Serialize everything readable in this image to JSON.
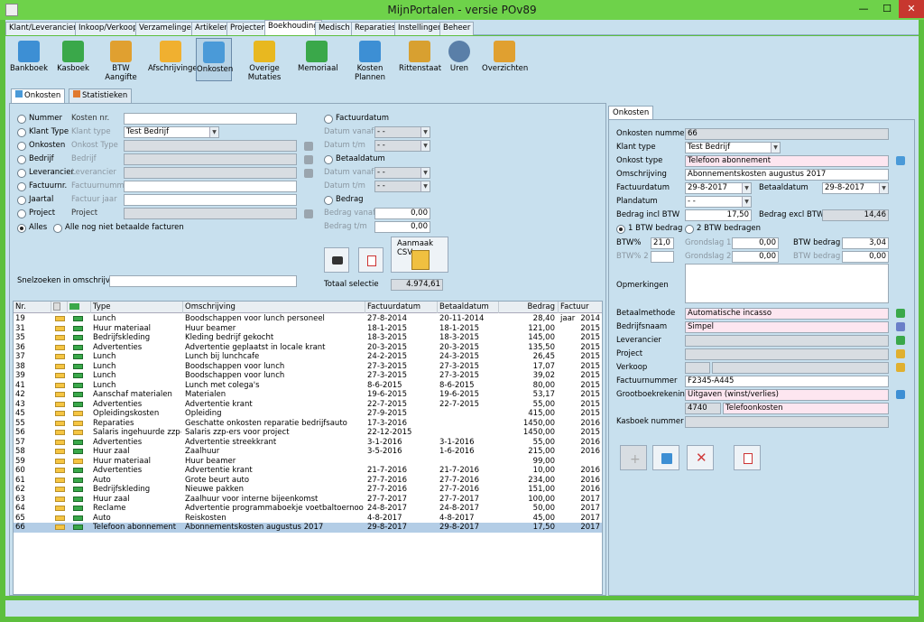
{
  "window": {
    "title": "MijnPortalen - versie POv89",
    "minimize": "—",
    "maximize": "☐",
    "close": "✕"
  },
  "menu": [
    "Klant/Leverancier",
    "Inkoop/Verkoop",
    "Verzamelingen",
    "Artikelen",
    "Projecten",
    "Boekhouding",
    "Medisch",
    "Reparaties",
    "Instellingen",
    "Beheer"
  ],
  "toolbar": [
    {
      "label": "Bankboek",
      "icon": "book-icon",
      "color": "#3d8fd4"
    },
    {
      "label": "Kasboek",
      "icon": "cashbox-icon",
      "color": "#3aa84a"
    },
    {
      "label": "BTW Aangifte",
      "icon": "tax-form-icon",
      "color": "#e0a030"
    },
    {
      "label": "Afschrijvingen",
      "icon": "folder-icon",
      "color": "#f0b030"
    },
    {
      "label": "Onkosten",
      "icon": "tag-icon",
      "color": "#4a9ad8"
    },
    {
      "label": "Overige Mutaties",
      "icon": "swap-folder-icon",
      "color": "#e8b820"
    },
    {
      "label": "Memoriaal",
      "icon": "arrows-icon",
      "color": "#3aa84a"
    },
    {
      "label": "Kosten Plannen",
      "icon": "bar-chart-icon",
      "color": "#3d8fd4"
    },
    {
      "label": "Rittenstaat",
      "icon": "car-icon",
      "color": "#d8a030"
    },
    {
      "label": "Uren",
      "icon": "clock-icon",
      "color": "#5a7fa8"
    },
    {
      "label": "Overzichten",
      "icon": "magnifier-icon",
      "color": "#e0a030"
    }
  ],
  "tabs": {
    "onkosten": "Onkosten",
    "statistieken": "Statistieken"
  },
  "filter": {
    "left": [
      {
        "radio": "Nummer",
        "label": "Kosten nr.",
        "value": "",
        "gray": false
      },
      {
        "radio": "Klant Type",
        "label": "Klant type",
        "value": "Test Bedrijf",
        "gray": false,
        "dropdown": true
      },
      {
        "radio": "Onkosten",
        "label": "Onkost Type",
        "value": "",
        "gray": true
      },
      {
        "radio": "Bedrijf",
        "label": "Bedrijf",
        "value": "",
        "gray": true
      },
      {
        "radio": "Leverancier",
        "label": "Leverancier",
        "value": "",
        "gray": true
      },
      {
        "radio": "Factuurnr.",
        "label": "Factuurnummer",
        "value": "",
        "gray": false
      },
      {
        "radio": "Jaartal",
        "label": "Factuur jaar",
        "value": "",
        "gray": false
      },
      {
        "radio": "Project",
        "label": "Project",
        "value": "",
        "gray": true
      }
    ],
    "alles": "Alles",
    "nietbetaald": "Alle nog niet betaalde facturen",
    "snelzoeken": "Snelzoeken in omschrijving",
    "factuurdatum": "Factuurdatum",
    "datum_vanaf": "Datum vanaf",
    "datum_tm": "Datum t/m",
    "betaaldatum": "Betaaldatum",
    "bedrag": "Bedrag",
    "bedrag_vanaf": "Bedrag vanaf",
    "bedrag_tm": "Bedrag t/m",
    "bedrag_vanaf_val": "0,00",
    "bedrag_tm_val": "0,00",
    "date_placeholder": "- -",
    "csv": "Aanmaak CSV",
    "totaal_label": "Totaal selectie",
    "totaal_value": "4.974,61"
  },
  "grid": {
    "headers": [
      "Nr.",
      "",
      "",
      "Type",
      "Omschrijving",
      "Factuurdatum",
      "Betaaldatum",
      "Bedrag",
      "Factuur jaar"
    ],
    "rows": [
      [
        "19",
        "Lunch",
        "Boodschappen voor lunch personeel",
        "27-8-2014",
        "20-11-2014",
        "28,40",
        "2014"
      ],
      [
        "31",
        "Huur materiaal",
        "Huur beamer",
        "18-1-2015",
        "18-1-2015",
        "121,00",
        "2015"
      ],
      [
        "35",
        "Bedrijfskleding",
        "Kleding bedrijf gekocht",
        "18-3-2015",
        "18-3-2015",
        "145,00",
        "2015"
      ],
      [
        "36",
        "Advertenties",
        "Advertentie geplaatst in locale krant",
        "20-3-2015",
        "20-3-2015",
        "135,50",
        "2015"
      ],
      [
        "37",
        "Lunch",
        "Lunch bij lunchcafe",
        "24-2-2015",
        "24-3-2015",
        "26,45",
        "2015"
      ],
      [
        "38",
        "Lunch",
        "Boodschappen voor lunch",
        "27-3-2015",
        "27-3-2015",
        "17,07",
        "2015"
      ],
      [
        "39",
        "Lunch",
        "Boodschappen voor lunch",
        "27-3-2015",
        "27-3-2015",
        "39,02",
        "2015"
      ],
      [
        "41",
        "Lunch",
        "Lunch met colega's",
        "8-6-2015",
        "8-6-2015",
        "80,00",
        "2015"
      ],
      [
        "42",
        "Aanschaf materialen",
        "Materialen",
        "19-6-2015",
        "19-6-2015",
        "53,17",
        "2015"
      ],
      [
        "43",
        "Advertenties",
        "Advertentie krant",
        "22-7-2015",
        "22-7-2015",
        "55,00",
        "2015"
      ],
      [
        "45",
        "Opleidingskosten",
        "Opleiding",
        "27-9-2015",
        "",
        "415,00",
        "2015"
      ],
      [
        "55",
        "Reparaties",
        "Geschatte onkosten reparatie bedrijfsauto",
        "17-3-2016",
        "",
        "1450,00",
        "2016"
      ],
      [
        "56",
        "Salaris ingehuurde zzp-ers",
        "Salaris zzp-ers voor project",
        "22-12-2015",
        "",
        "1450,00",
        "2015"
      ],
      [
        "57",
        "Advertenties",
        "Advertentie streekkrant",
        "3-1-2016",
        "3-1-2016",
        "55,00",
        "2016"
      ],
      [
        "58",
        "Huur zaal",
        "Zaalhuur",
        "3-5-2016",
        "1-6-2016",
        "215,00",
        "2016"
      ],
      [
        "59",
        "Huur materiaal",
        "Huur beamer",
        "",
        "",
        "99,00",
        ""
      ],
      [
        "60",
        "Advertenties",
        "Advertentie krant",
        "21-7-2016",
        "21-7-2016",
        "10,00",
        "2016"
      ],
      [
        "61",
        "Auto",
        "Grote beurt auto",
        "27-7-2016",
        "27-7-2016",
        "234,00",
        "2016"
      ],
      [
        "62",
        "Bedrijfskleding",
        "Nieuwe pakken",
        "27-7-2016",
        "27-7-2016",
        "151,00",
        "2016"
      ],
      [
        "63",
        "Huur zaal",
        "Zaalhuur voor interne bijeenkomst",
        "27-7-2017",
        "27-7-2017",
        "100,00",
        "2017"
      ],
      [
        "64",
        "Reclame",
        "Advertentie programmaboekje voetbaltoernooi",
        "24-8-2017",
        "24-8-2017",
        "50,00",
        "2017"
      ],
      [
        "65",
        "Auto",
        "Reiskosten",
        "4-8-2017",
        "4-8-2017",
        "45,00",
        "2017"
      ],
      [
        "66",
        "Telefoon abonnement",
        "Abonnementskosten augustus 2017",
        "29-8-2017",
        "29-8-2017",
        "17,50",
        "2017"
      ]
    ]
  },
  "detail": {
    "tab": "Onkosten",
    "nummer_label": "Onkosten nummer",
    "nummer": "66",
    "klanttype_label": "Klant type",
    "klanttype": "Test Bedrijf",
    "onkosttype_label": "Onkost type",
    "onkosttype": "Telefoon abonnement",
    "omschrijving_label": "Omschrijving",
    "omschrijving": "Abonnementskosten augustus 2017",
    "factuurdatum_label": "Factuurdatum",
    "factuurdatum": "29-8-2017",
    "betaaldatum_label": "Betaaldatum",
    "betaaldatum": "29-8-2017",
    "plandatum_label": "Plandatum",
    "plandatum": "- -",
    "incl_label": "Bedrag incl BTW",
    "incl": "17,50",
    "excl_label": "Bedrag excl BTW",
    "excl": "14,46",
    "btw1": "1 BTW bedrag",
    "btw2": "2 BTW bedragen",
    "btwpct_label": "BTW%",
    "btwpct": "21,0",
    "grondslag1_label": "Grondslag 1",
    "grondslag1": "0,00",
    "btwbedrag_label": "BTW bedrag",
    "btwbedrag": "3,04",
    "btwpct2_label": "BTW% 2",
    "btwpct2": "",
    "grondslag2_label": "Grondslag 2",
    "grondslag2": "0,00",
    "btwbedrag2_label": "BTW bedrag 2",
    "btwbedrag2": "0,00",
    "opmerkingen_label": "Opmerkingen",
    "betaalmethode_label": "Betaalmethode",
    "betaalmethode": "Automatische incasso",
    "bedrijfsnaam_label": "Bedrijfsnaam",
    "bedrijfsnaam": "Simpel",
    "leverancier_label": "Leverancier",
    "leverancier": "",
    "project_label": "Project",
    "project": "",
    "verkoop_label": "Verkoop",
    "verkoop": "",
    "factuurnr_label": "Factuurnummer",
    "factuurnr": "F2345-A445",
    "grootboek_label": "Grootboekrekening",
    "grootboek": "Uitgaven (winst/verlies)",
    "grootboek_nr": "4740",
    "grootboek_naam": "Telefoonkosten",
    "kasboek_label": "Kasboek nummer",
    "kasboek": ""
  }
}
